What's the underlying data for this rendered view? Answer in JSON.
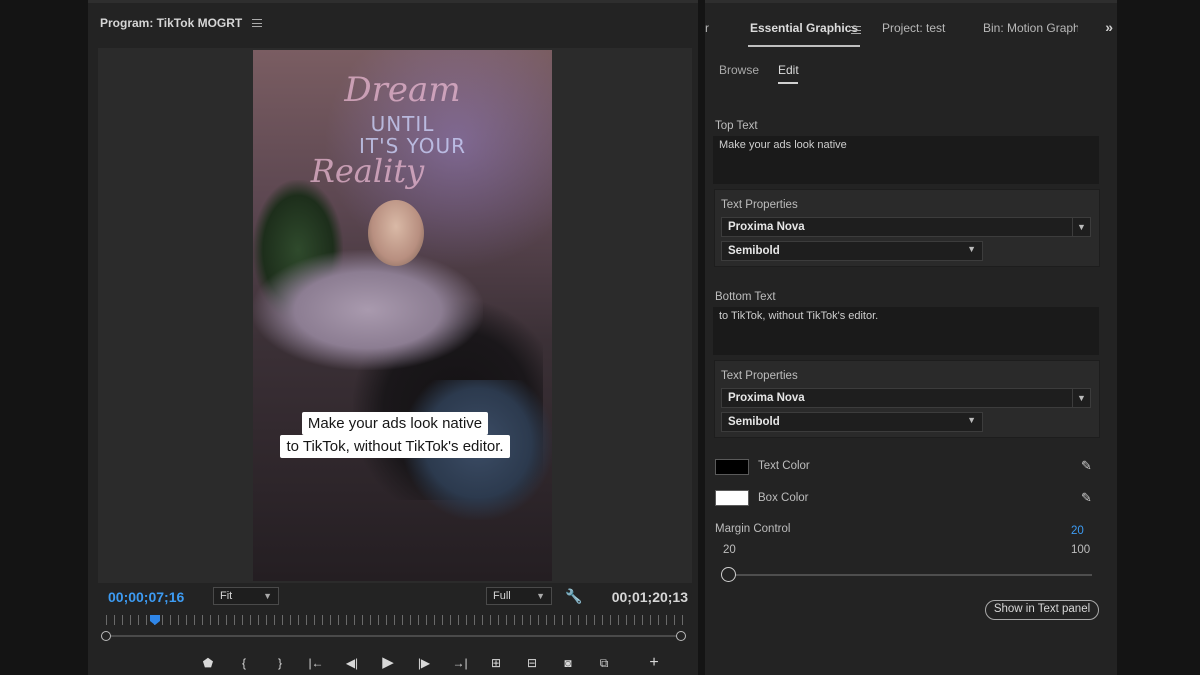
{
  "program": {
    "title": "Program: TikTok MOGRT",
    "timecode_current": "00;00;07;16",
    "timecode_duration": "00;01;20;13",
    "zoom_select": "Fit",
    "resolution_select": "Full",
    "video": {
      "neon_line1": "Dream",
      "neon_line2": "UNTIL",
      "neon_line3": "IT'S YOUR",
      "neon_line4": "Reality",
      "caption_line1": "Make your ads look native",
      "caption_line2": "to TikTok, without TikTok's editor."
    },
    "transport_icons": [
      "add-marker-icon",
      "mark-in-icon",
      "mark-out-icon",
      "go-to-in-icon",
      "step-back-icon",
      "play-icon",
      "step-forward-icon",
      "go-to-out-icon",
      "lift-icon",
      "extract-icon",
      "export-frame-icon",
      "comparison-view-icon",
      "add-button-icon"
    ]
  },
  "essential_graphics": {
    "tabs": {
      "partial_left": "r",
      "active": "Essential Graphics",
      "project": "Project: test",
      "bin": "Bin: Motion Graphi"
    },
    "subtabs": {
      "browse": "Browse",
      "edit": "Edit"
    },
    "top_text": {
      "label": "Top Text",
      "value": "Make your ads look native",
      "properties_label": "Text Properties",
      "font": "Proxima Nova",
      "weight": "Semibold"
    },
    "bottom_text": {
      "label": "Bottom Text",
      "value": "to TikTok, without TikTok's editor.",
      "properties_label": "Text Properties",
      "font": "Proxima Nova",
      "weight": "Semibold"
    },
    "text_color": {
      "label": "Text Color",
      "color": "#000000"
    },
    "box_color": {
      "label": "Box Color",
      "color": "#ffffff"
    },
    "margin_control": {
      "label": "Margin Control",
      "value": "20",
      "min": "20",
      "max": "100"
    },
    "show_in_text_panel": "Show in Text panel"
  },
  "colors": {
    "timecode_blue": "#3d9bf2",
    "playhead_blue": "#2f86e8",
    "panel_bg": "#232323",
    "margin_value_blue": "#3d9bf2"
  }
}
